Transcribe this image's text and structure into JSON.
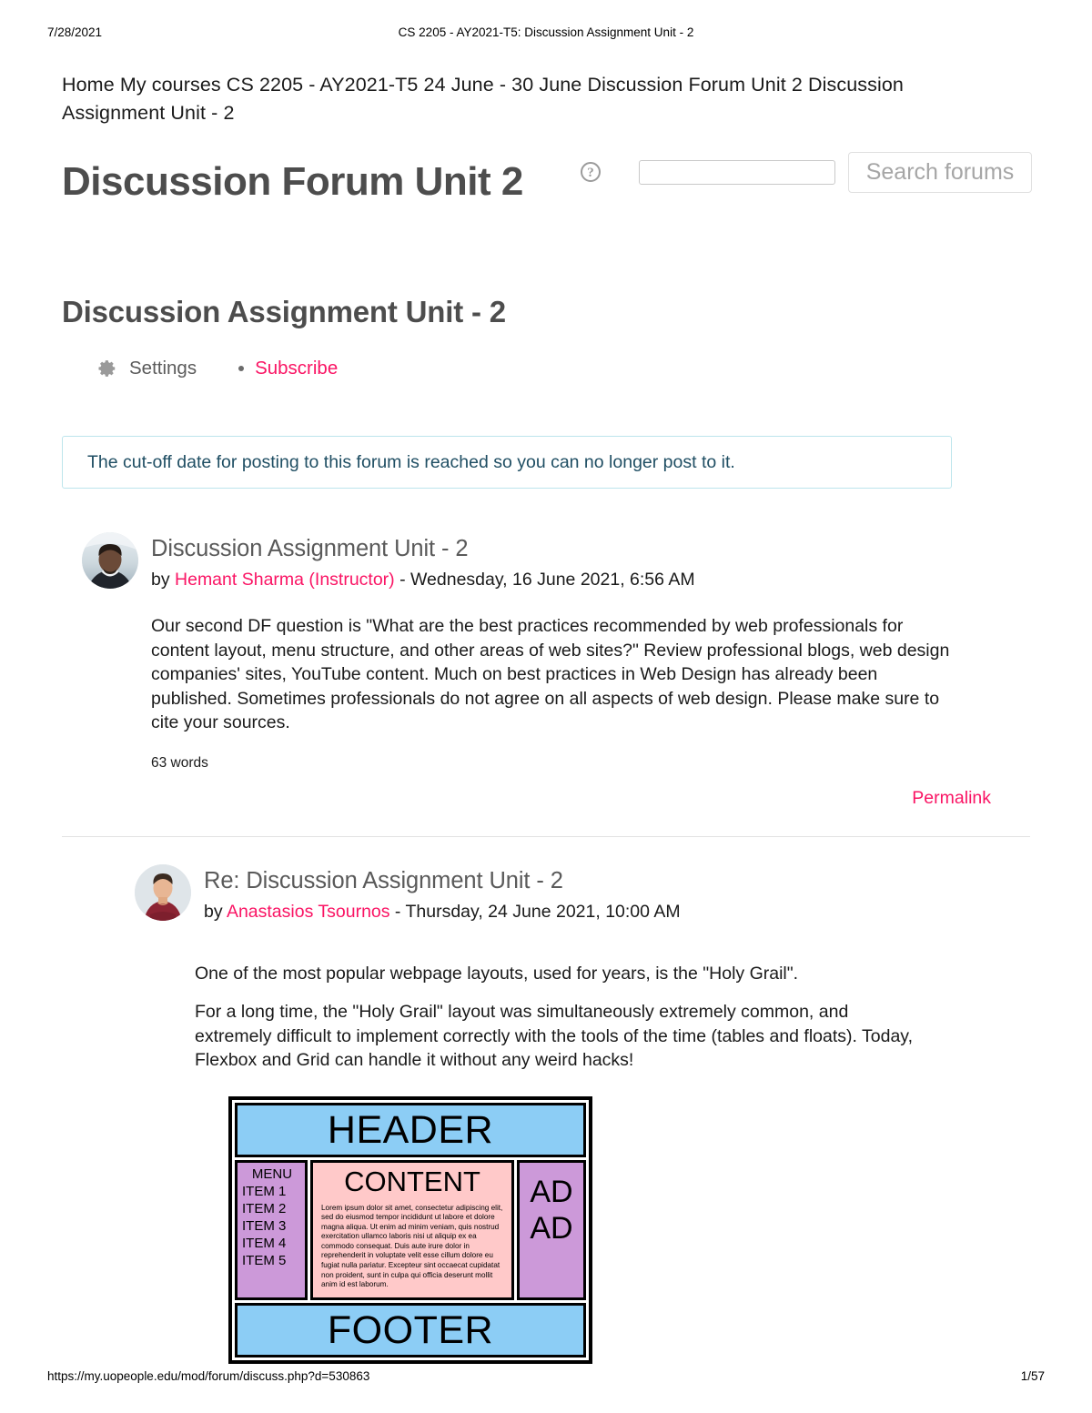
{
  "print": {
    "date": "7/28/2021",
    "header_title": "CS 2205 - AY2021-T5: Discussion Assignment Unit - 2",
    "footer_url": "https://my.uopeople.edu/mod/forum/discuss.php?d=530863",
    "page_number": "1/57"
  },
  "breadcrumb": {
    "text": "Home My courses CS 2205 - AY2021-T5 24 June - 30 June Discussion Forum Unit 2 Discussion Assignment Unit - 2"
  },
  "header": {
    "forum_title": "Discussion Forum Unit 2",
    "assignment_title": "Discussion Assignment Unit - 2",
    "help_icon_label": "?"
  },
  "search": {
    "value": "",
    "placeholder": "",
    "button_label": "Search forums"
  },
  "actions": {
    "settings_label": "Settings",
    "subscribe_label": "Subscribe"
  },
  "alert": {
    "text": "The cut-off date for posting to this forum is reached so you can no longer post to it.",
    "border_color": "#bde5ec",
    "text_color": "#1f4e63"
  },
  "colors": {
    "accent_pink": "#fa1464",
    "heading_gray": "#4d4d4d",
    "diagram_blue": "#8ccdf5",
    "diagram_purple": "#cc99d9",
    "diagram_pink": "#ffc9c9"
  },
  "posts": [
    {
      "subject": "Discussion Assignment Unit - 2",
      "by_prefix": "by ",
      "author": "Hemant Sharma (Instructor)",
      "date": " - Wednesday, 16 June 2021, 6:56 AM",
      "paragraphs": [
        "Our second DF question is \"What are the best practices recommended by web professionals for content layout, menu structure, and other areas of web sites?\" Review professional blogs, web design companies' sites, YouTube content. Much on best practices in Web Design has already been published. Sometimes professionals do not agree on all aspects of web design. Please make sure to cite your sources."
      ],
      "wordcount": "63 words",
      "permalink_label": "Permalink"
    },
    {
      "subject": "Re: Discussion Assignment Unit - 2",
      "by_prefix": "by ",
      "author": "Anastasios Tsournos",
      "date": " - Thursday, 24 June 2021, 10:00 AM",
      "paragraphs": [
        "One of the most popular webpage layouts, used for years, is the \"Holy Grail\".",
        "For a long time, the \"Holy Grail\" layout was simultaneously extremely common, and extremely difficult to implement correctly with the tools of the time (tables and floats). Today,  Flexbox and Grid can handle it without any weird hacks!"
      ]
    }
  ],
  "diagram": {
    "header": "HEADER",
    "footer": "FOOTER",
    "menu_title": "MENU",
    "menu_items": [
      "ITEM 1",
      "ITEM 2",
      "ITEM 3",
      "ITEM 4",
      "ITEM 5"
    ],
    "content_title": "CONTENT",
    "content_body": "Lorem ipsum dolor sit amet, consectetur adipiscing elit, sed do eiusmod tempor incididunt ut labore et dolore magna aliqua. Ut enim ad minim veniam, quis nostrud exercitation ullamco laboris nisi ut aliquip ex ea commodo consequat. Duis aute irure dolor in reprehenderit in voluptate velit esse cillum dolore eu fugiat nulla pariatur. Excepteur sint occaecat cupidatat non proident, sunt in culpa qui officia deserunt mollit anim id est laborum.",
    "ad_line_1": "AD",
    "ad_line_2": "AD"
  }
}
